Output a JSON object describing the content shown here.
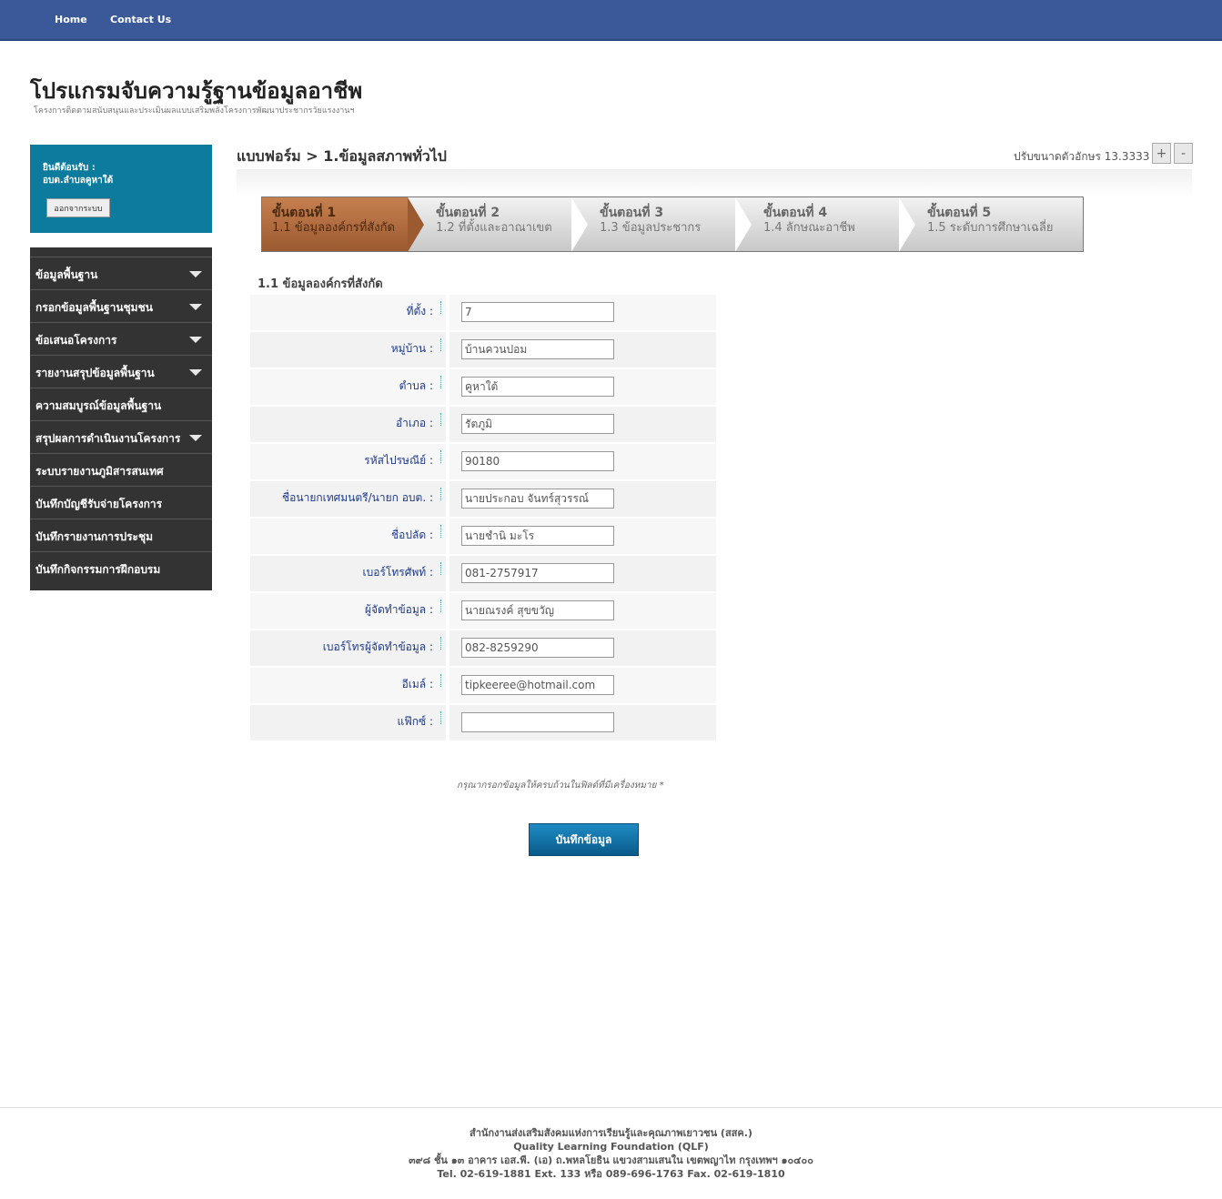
{
  "nav": {
    "home": "Home",
    "contact": "Contact Us"
  },
  "site": {
    "title": "โปรแกรมจับความรู้ฐานข้อมูลอาชีพ",
    "subtitle": "โครงการติดตามสนับสนุนและประเมินผลแบบเสริมพลังโครงการพัฒนาประชากรวัยแรงงานฯ"
  },
  "welcome": {
    "greeting": "ยินดีต้อนรับ :",
    "user": "อบต.ลำบลคูหาใต้",
    "logout": "ออกจากระบบ"
  },
  "menu": {
    "items": [
      {
        "label": "ข้อมูลพื้นฐาน",
        "dropdown": true
      },
      {
        "label": "กรอกข้อมูลพื้นฐานชุมชน",
        "dropdown": true
      },
      {
        "label": "ข้อเสนอโครงการ",
        "dropdown": true
      },
      {
        "label": "รายงานสรุปข้อมูลพื้นฐาน",
        "dropdown": true
      },
      {
        "label": "ความสมบูรณ์ข้อมูลพื้นฐาน",
        "dropdown": false
      },
      {
        "label": "สรุปผลการดำเนินงานโครงการ",
        "dropdown": true
      },
      {
        "label": "ระบบรายงานภูมิสารสนเทศ",
        "dropdown": false
      },
      {
        "label": "บันทึกบัญชีรับจ่ายโครงการ",
        "dropdown": false
      },
      {
        "label": "บันทึกรายงานการประชุม",
        "dropdown": false
      },
      {
        "label": "บันทึกกิจกรรมการฝึกอบรม",
        "dropdown": false
      }
    ]
  },
  "breadcrumb": "แบบฟอร์ม > 1.ข้อมูลสภาพทั่วไป",
  "font_size": {
    "label": "ปรับขนาดตัวอักษร 13.3333",
    "plus": "+",
    "minus": "-"
  },
  "steps": [
    {
      "title": "ขั้นตอนที่ 1",
      "sub": "1.1 ข้อมูลองค์กรที่สังกัด",
      "active": true
    },
    {
      "title": "ขั้นตอนที่ 2",
      "sub": "1.2 ที่ตั้งและอาณาเขต",
      "active": false
    },
    {
      "title": "ขั้นตอนที่ 3",
      "sub": "1.3 ข้อมูลประชากร",
      "active": false
    },
    {
      "title": "ขั้นตอนที่ 4",
      "sub": "1.4 ลักษณะอาชีพ",
      "active": false
    },
    {
      "title": "ขั้นตอนที่ 5",
      "sub": "1.5 ระดับการศึกษาเฉลี่ย",
      "active": false
    }
  ],
  "section_title": "1.1 ข้อมูลองค์กรที่สังกัด",
  "fields": [
    {
      "label": "ที่ตั้ง :",
      "value": "7"
    },
    {
      "label": "หมู่บ้าน :",
      "value": "บ้านควนปอม"
    },
    {
      "label": "ตำบล :",
      "value": "คูหาใต้"
    },
    {
      "label": "อำเภอ :",
      "value": "รัตภูมิ"
    },
    {
      "label": "รหัสไปรษณีย์ :",
      "value": "90180"
    },
    {
      "label": "ชื่อนายกเทศมนตรี/นายก อบต. :",
      "value": "นายประกอบ จันทร์สุวรรณ์"
    },
    {
      "label": "ชื่อปลัด :",
      "value": "นายชำนิ มะโร"
    },
    {
      "label": "เบอร์โทรศัพท์ :",
      "value": "081-2757917"
    },
    {
      "label": "ผู้จัดทำข้อมูล :",
      "value": "นายณรงค์ สุขขวัญ"
    },
    {
      "label": "เบอร์โทรผู้จัดทำข้อมูล :",
      "value": "082-8259290"
    },
    {
      "label": "อีเมล์ :",
      "value": "tipkeeree@hotmail.com"
    },
    {
      "label": "แฟ๊กซ์ :",
      "value": ""
    }
  ],
  "note": "กรุณากรอกข้อมูลให้ครบถ้วนในฟิลด์ที่มีเครื่องหมาย *",
  "save_button": "บันทึกข้อมูล",
  "footer": {
    "line1": "สำนักงานส่งเสริมสังคมแห่งการเรียนรู้และคุณภาพเยาวชน (สสค.)",
    "line2": "Quality Learning Foundation (QLF)",
    "line3": "๓๙๘ ชั้น ๑๓ อาคาร เอส.พี. (เอ) ถ.พหลโยธิน แขวงสามเสนใน เขตพญาไท กรุงเทพฯ ๑๐๔๐๐",
    "line4": "Tel. 02-619-1881 Ext. 133 หรือ 089-696-1763 Fax. 02-619-1810"
  },
  "colors": {
    "nav_bg": "#3b5998",
    "sidebar_accent": "#0d7b9d",
    "menu_bg": "#333333",
    "active_step": "#b06a3c",
    "save_button": "#1277aa"
  }
}
